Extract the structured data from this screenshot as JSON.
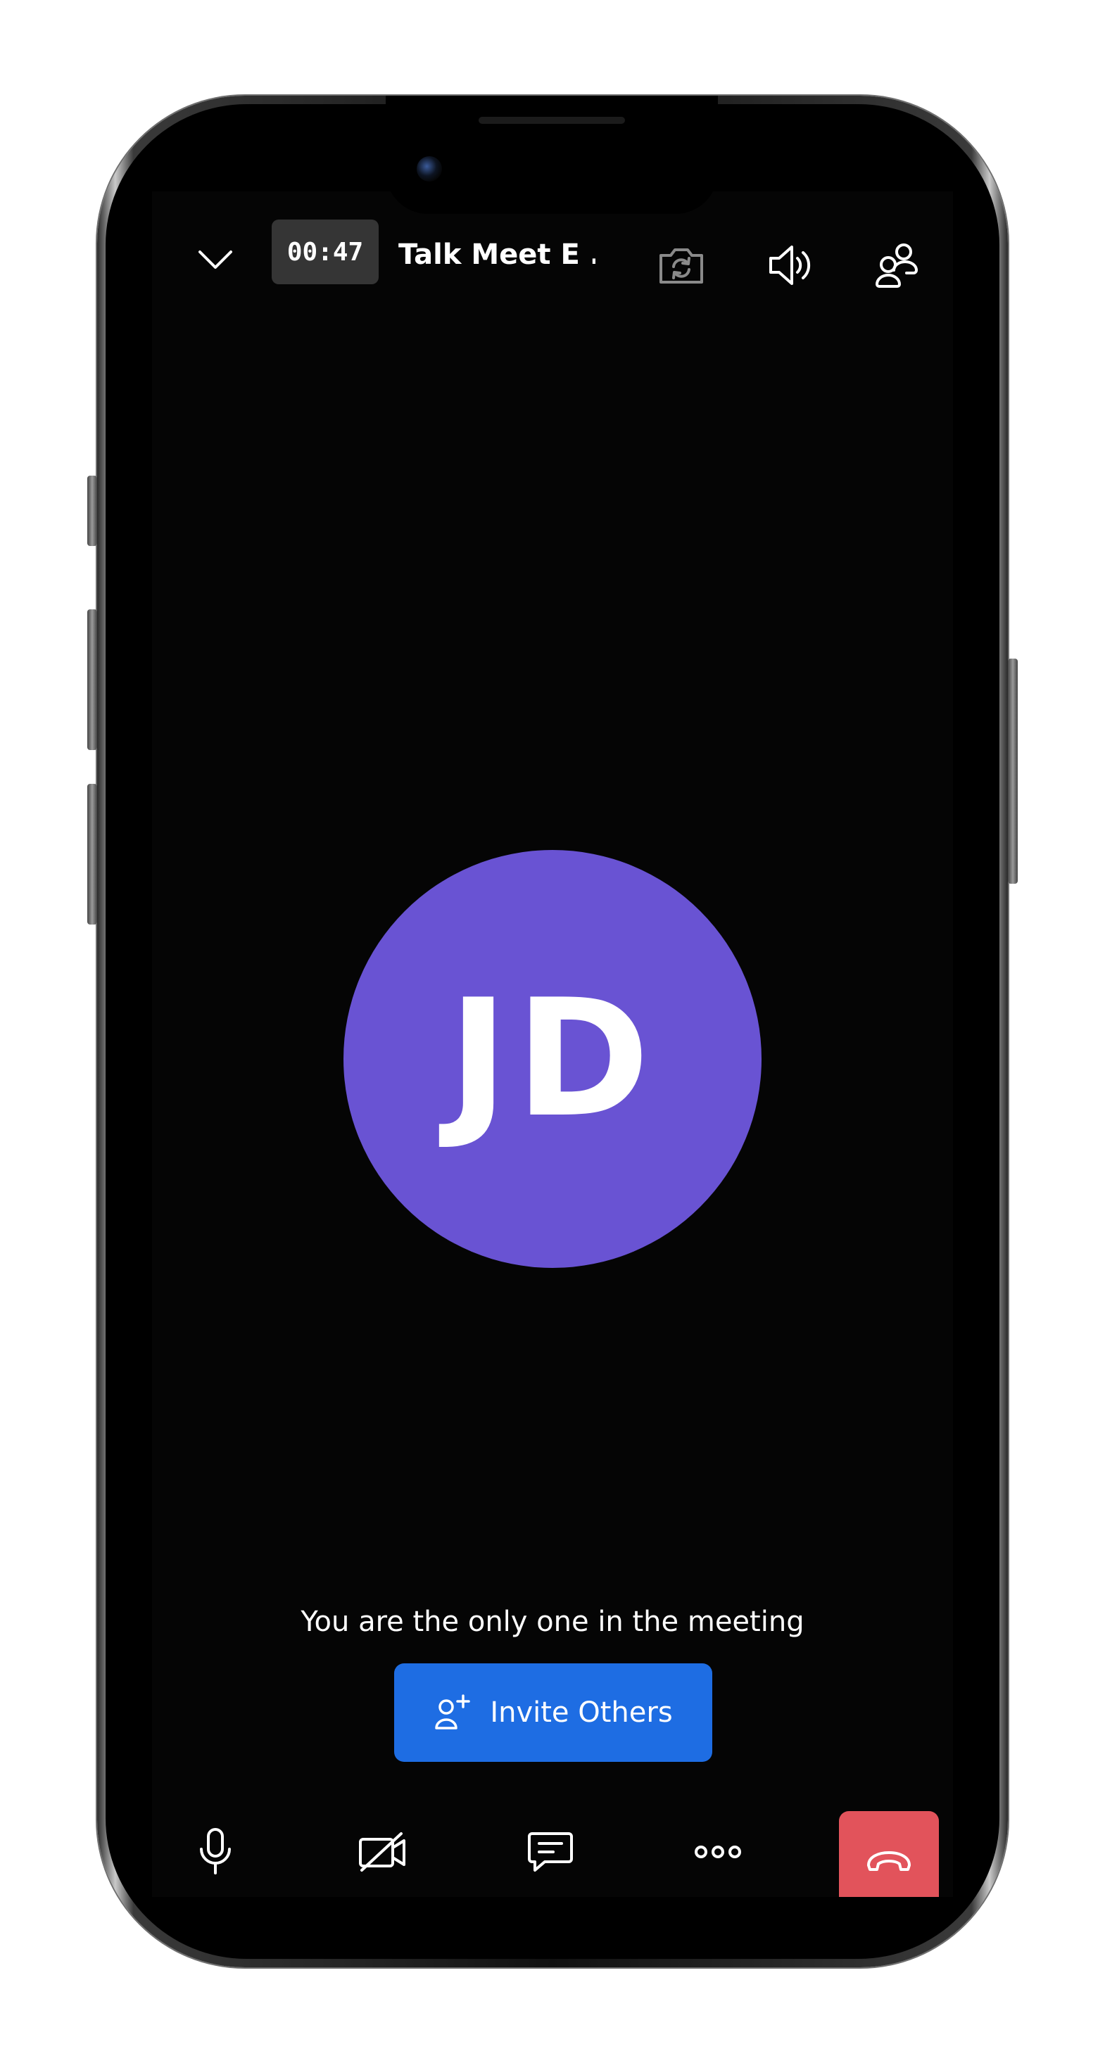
{
  "header": {
    "timer": "00:47",
    "meeting_title": "Talk Meet E ..."
  },
  "participant": {
    "initials": "JD",
    "avatar_color": "#6953d3"
  },
  "status": {
    "alone_message": "You are the only one in the meeting"
  },
  "invite": {
    "label": "Invite Others",
    "color": "#1e6de3"
  },
  "toolbar": {
    "icons": [
      "microphone-icon",
      "video-off-icon",
      "chat-icon",
      "more-icon",
      "end-call-icon"
    ],
    "end_call_color": "#e2535b"
  }
}
